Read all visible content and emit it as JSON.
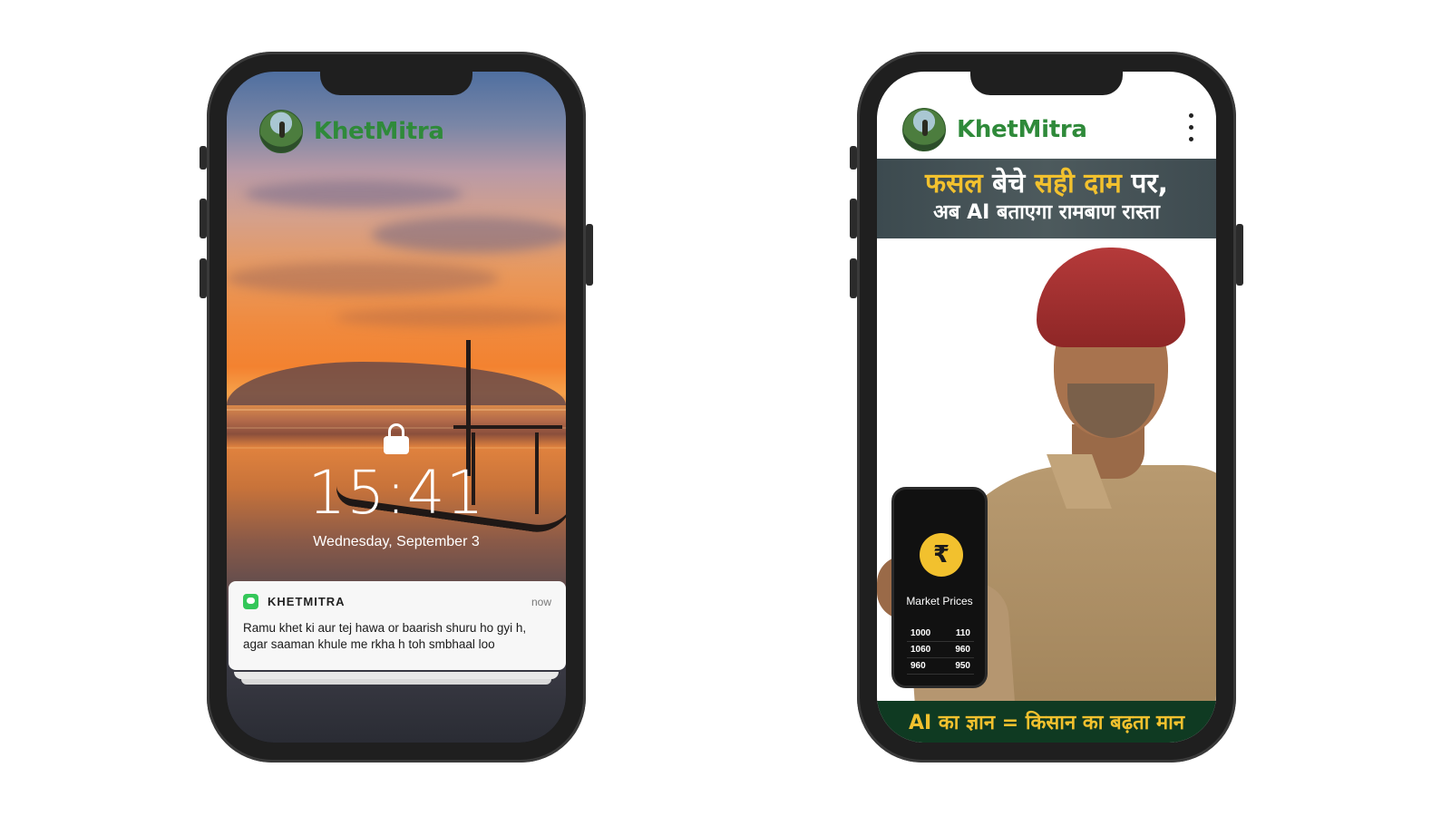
{
  "left_phone": {
    "brand_name": "KhetMitra",
    "lock_screen": {
      "time": "15:41",
      "date": "Wednesday, September 3"
    },
    "notification": {
      "app_name": "KHETMITRA",
      "timestamp": "now",
      "message": "Ramu khet ki aur tej hawa or baarish shuru ho gyi h, agar saaman khule me rkha h toh smbhaal loo"
    }
  },
  "right_phone": {
    "brand_name": "KhetMitra",
    "banner": {
      "line1_part1": "फसल ",
      "line1_part2": "बेचे ",
      "line1_highlight": "सही दाम",
      "line1_part3": " पर,",
      "line2": "अब AI बताएगा रामबाण रास्ता"
    },
    "market_prices_card": {
      "currency_symbol": "₹",
      "title": "Market Prices",
      "rows": [
        [
          "1000",
          "110"
        ],
        [
          "1060",
          "960"
        ],
        [
          "960",
          "950"
        ]
      ]
    },
    "slogan": "AI का ज्ञान = किसान का बढ़ता मान"
  },
  "colors": {
    "brand_green": "#2f8a3a",
    "highlight_yellow": "#f2c12e",
    "notification_icon": "#34c759"
  }
}
